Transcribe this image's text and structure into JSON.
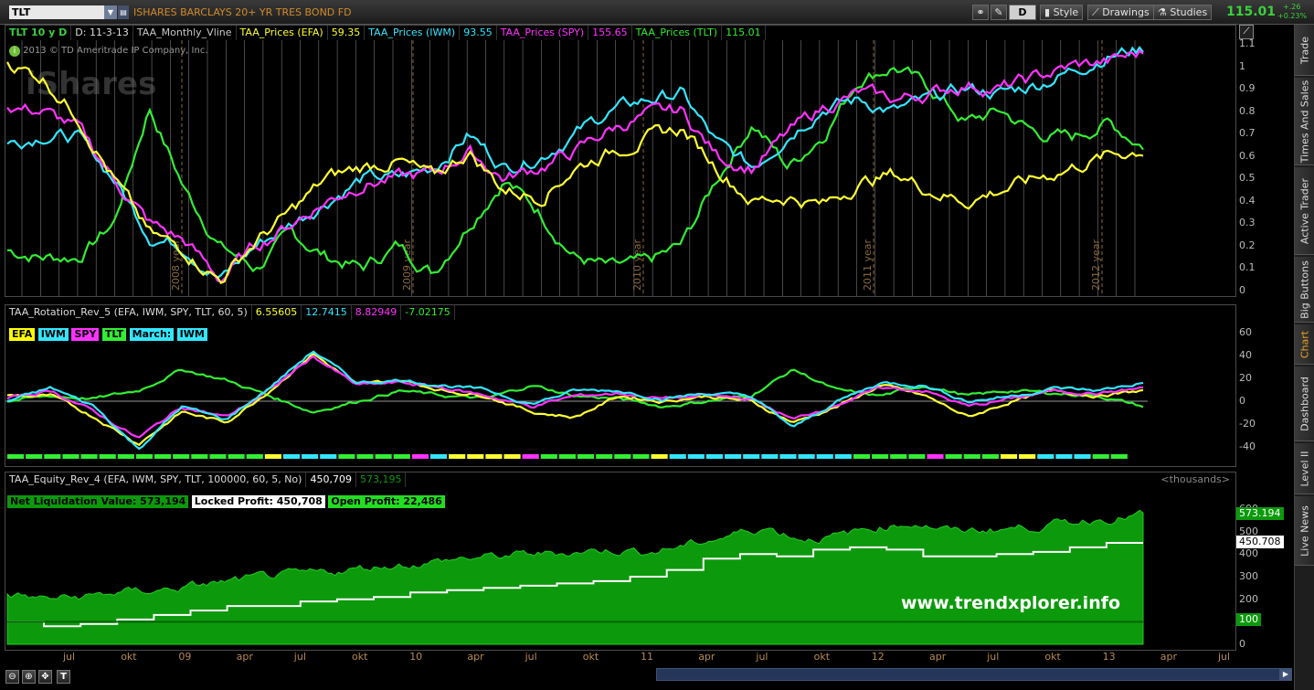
{
  "toolbar": {
    "symbol": "TLT",
    "instrument_name": "ISHARES BARCLAYS 20+ YR TRES BOND FD",
    "drawing_mode": "D",
    "style_label": "Style",
    "drawings_label": "Drawings",
    "studies_label": "Studies",
    "last_price": "115.01",
    "change_abs": "+.26",
    "change_pct": "+0.23%"
  },
  "price_panel": {
    "chart_id": "TLT 10 y D",
    "date": "D: 11-3-13",
    "studies": [
      {
        "label": "TAA_Monthly_Vline",
        "color": "#c8c8c8"
      },
      {
        "label": "TAA_Prices (EFA)",
        "value": "59.35",
        "color": "#ffff33"
      },
      {
        "label": "TAA_Prices (IWM)",
        "value": "93.55",
        "color": "#33e6ff"
      },
      {
        "label": "TAA_Prices (SPY)",
        "value": "155.65",
        "color": "#ff33ff"
      },
      {
        "label": "TAA_Prices (TLT)",
        "value": "115.01",
        "color": "#33ee33"
      }
    ],
    "copyright": "2013 © TD Ameritrade IP Company, Inc.",
    "watermark": "iShares",
    "year_labels": [
      "2008 year",
      "2009 year",
      "2010 year",
      "2011 year",
      "2012 year"
    ],
    "y_ticks": [
      "1.1",
      "1",
      "0.9",
      "0.8",
      "0.7",
      "0.6",
      "0.5",
      "0.4",
      "0.3",
      "0.2",
      "0.1",
      "0"
    ]
  },
  "rotation_panel": {
    "study_label": "TAA_Rotation_Rev_5 (EFA, IWM, SPY, TLT, 60, 5)",
    "values": [
      {
        "value": "6.55605",
        "color": "#ffff33"
      },
      {
        "value": "12.7415",
        "color": "#33e6ff"
      },
      {
        "value": "8.82949",
        "color": "#ff33ff"
      },
      {
        "value": "-7.02175",
        "color": "#33ee33"
      }
    ],
    "badges": [
      {
        "label": "EFA",
        "bg": "#ffff00"
      },
      {
        "label": "IWM",
        "bg": "#33e6ff"
      },
      {
        "label": "SPY",
        "bg": "#ff33ff"
      },
      {
        "label": "TLT",
        "bg": "#33ee33"
      },
      {
        "label": "March:",
        "bg": "#33e6ff"
      },
      {
        "label": "IWM",
        "bg": "#33e6ff"
      }
    ],
    "y_ticks": [
      "60",
      "40",
      "20",
      "0",
      "-20",
      "-40"
    ]
  },
  "equity_panel": {
    "study_label": "TAA_Equity_Rev_4 (EFA, IWM, SPY, TLT, 100000, 60, 5, No)",
    "value_locked": "450,709",
    "value_net": "573,195",
    "units": "<thousands>",
    "net_liquidation": "Net Liquidation Value: 573,194",
    "locked_profit": "Locked Profit: 450,708",
    "open_profit": "Open Profit: 22,486",
    "tag_net": "573.194",
    "tag_locked": "450.708",
    "tag_base": "100",
    "website": "www.trendxplorer.info",
    "y_ticks": [
      "600",
      "500",
      "400",
      "300",
      "200",
      "100",
      "0"
    ]
  },
  "x_axis_months": [
    "jul",
    "okt",
    "09",
    "apr",
    "jul",
    "okt",
    "10",
    "apr",
    "jul",
    "okt",
    "11",
    "apr",
    "jul",
    "okt",
    "12",
    "apr",
    "jul",
    "okt",
    "13",
    "apr",
    "jul"
  ],
  "right_tabs": [
    {
      "label": "Trade",
      "active": false
    },
    {
      "label": "Times And Sales",
      "active": false
    },
    {
      "label": "Active Trader",
      "active": false
    },
    {
      "label": "Big Buttons",
      "active": false
    },
    {
      "label": "Chart",
      "active": true
    },
    {
      "label": "Dashboard",
      "active": false
    },
    {
      "label": "Level II",
      "active": false
    },
    {
      "label": "Live News",
      "active": false
    }
  ],
  "bottom_tools": [
    "zoom-out-icon",
    "zoom-in-icon",
    "pan-icon",
    "text-tool-icon"
  ],
  "colors": {
    "efa": "#ffff33",
    "iwm": "#33e6ff",
    "spy": "#ff33ff",
    "tlt": "#33ee33",
    "equity_fill": "#0c9a0c",
    "axis_text": "#bbbbbb",
    "month_text": "#b58a50"
  }
}
